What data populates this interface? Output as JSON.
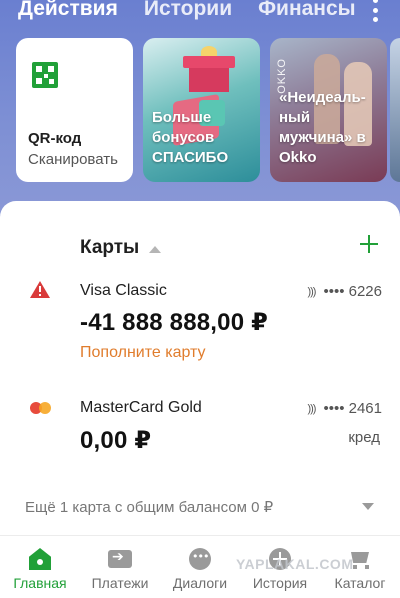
{
  "top_tabs": [
    "Действия",
    "Истории",
    "Финансы"
  ],
  "stories": {
    "qr": {
      "title": "QR-код",
      "subtitle": "Сканировать"
    },
    "bonus": {
      "text": "Больше бонусов СПАСИБО"
    },
    "okko": {
      "text": "«Неидеаль-ный мужчина» в Okko",
      "side_text": "OKKO"
    }
  },
  "cards_section": {
    "title": "Карты"
  },
  "cards": [
    {
      "name": "Visa Classic",
      "balance": "-41 888 888,00 ₽",
      "number": "•••• 6226",
      "action": "Пополните карту",
      "icon": "warning-icon"
    },
    {
      "name": "MasterCard Gold",
      "balance": "0,00 ₽",
      "number": "•••• 2461",
      "type": "кред",
      "icon": "mastercard-icon"
    }
  ],
  "more_cards": "Ещё 1 карта с общим балансом 0 ₽",
  "nav": [
    {
      "label": "Главная",
      "icon": "home-icon",
      "active": true
    },
    {
      "label": "Платежи",
      "icon": "payments-icon"
    },
    {
      "label": "Диалоги",
      "icon": "chat-icon"
    },
    {
      "label": "История",
      "icon": "history-icon"
    },
    {
      "label": "Каталог",
      "icon": "cart-icon"
    }
  ],
  "watermark": "YAPLAKAL.COM",
  "colors": {
    "accent": "#21a038",
    "warning": "#d93a3a",
    "action": "#e07c2c",
    "hero": "#6f84c9"
  }
}
